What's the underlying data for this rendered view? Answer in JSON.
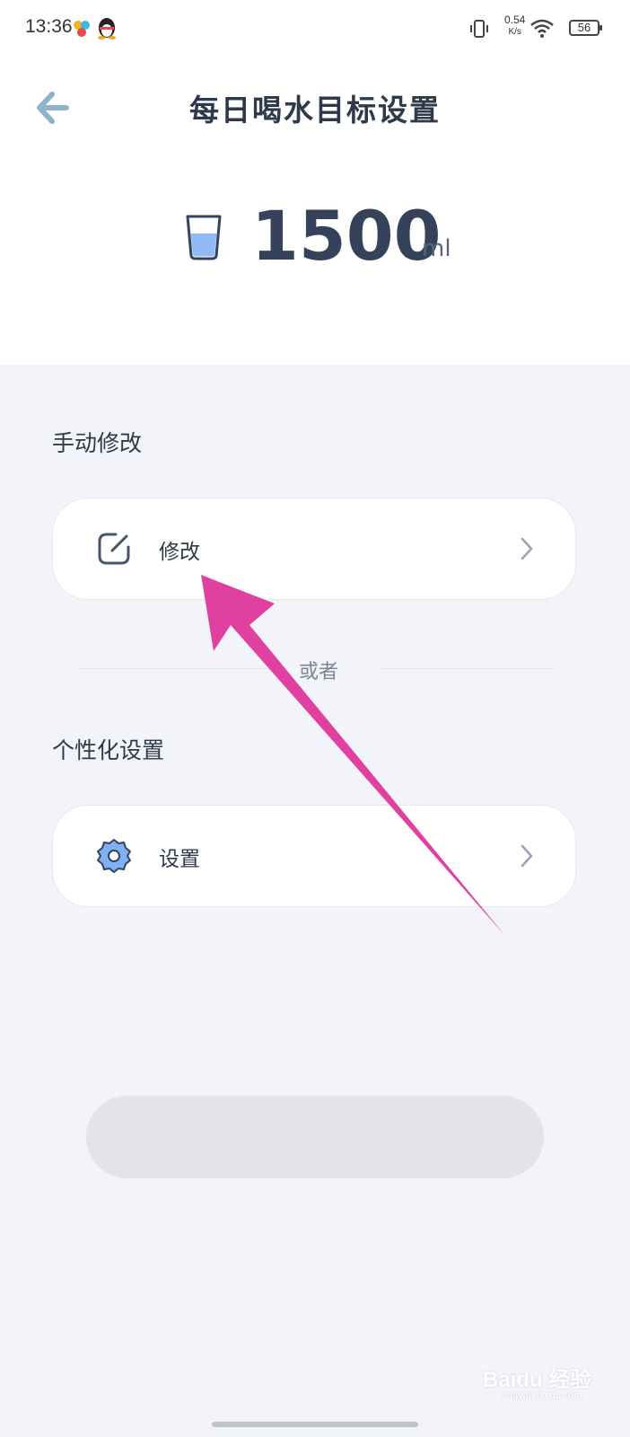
{
  "status_bar": {
    "time": "13:36",
    "net_speed": "0.54",
    "net_unit": "K/s",
    "battery": "56"
  },
  "header": {
    "title": "每日喝水目标设置"
  },
  "goal": {
    "amount": "1500",
    "unit": "ml"
  },
  "manual": {
    "section_label": "手动修改",
    "card_label": "修改"
  },
  "divider_text": "或者",
  "personal": {
    "section_label": "个性化设置",
    "card_label": "设置"
  },
  "watermark": {
    "brand": "Baidu 经验",
    "url": "jingyan.baidu.com"
  },
  "colors": {
    "accent_blue": "#6fa3f0",
    "annotation_arrow": "#e040a0"
  },
  "icons": {
    "back": "arrow-left-icon",
    "cup": "water-cup-icon",
    "edit": "edit-icon",
    "gear": "gear-icon",
    "chevron": "chevron-right-icon"
  }
}
